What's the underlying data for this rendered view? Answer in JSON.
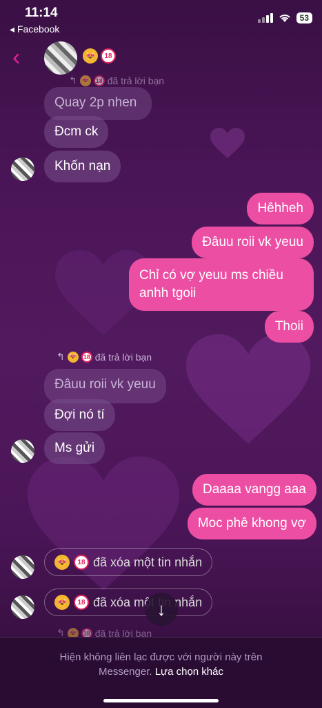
{
  "status": {
    "time": "11:14",
    "back_app": "◂ Facebook",
    "battery": "53"
  },
  "header": {
    "back_icon": "‹"
  },
  "messages": {
    "top_reply_note": "đã trả lời bạn",
    "quote1": "Quay 2p nhen",
    "in1": "Đcm ck",
    "in2": "Khốn nạn",
    "out1": "Hêhheh",
    "out2": "Đâuu roii vk yeuu",
    "out3_line1": "Chỉ có vợ yeuu ms chiều",
    "out3_line2": "anhh tgoii",
    "out4": "Thoii",
    "reply_note": "đã trả lời bạn",
    "quote2": "Đâuu roii vk yeuu",
    "in3": "Đợi nó tí",
    "in4": "Ms gửi",
    "out5": "Daaaa vangg aaa",
    "out6": "Moc phê khong vợ",
    "deleted1": "đã xóa một tin nhắn",
    "deleted2": "đã xóa một tin nhắn",
    "bottom_reply_note": "đã trả lời bạn"
  },
  "emoji": {
    "cat": "😻",
    "eighteen": "18"
  },
  "scroll_icon": "↓",
  "footer": {
    "line1": "Hiện không liên lạc được với người này trên",
    "line2_prefix": "Messenger.",
    "line2_link": "Lựa chọn khác"
  },
  "colors": {
    "accent": "#e91e9b",
    "outgoing": "#ec4ea3"
  }
}
